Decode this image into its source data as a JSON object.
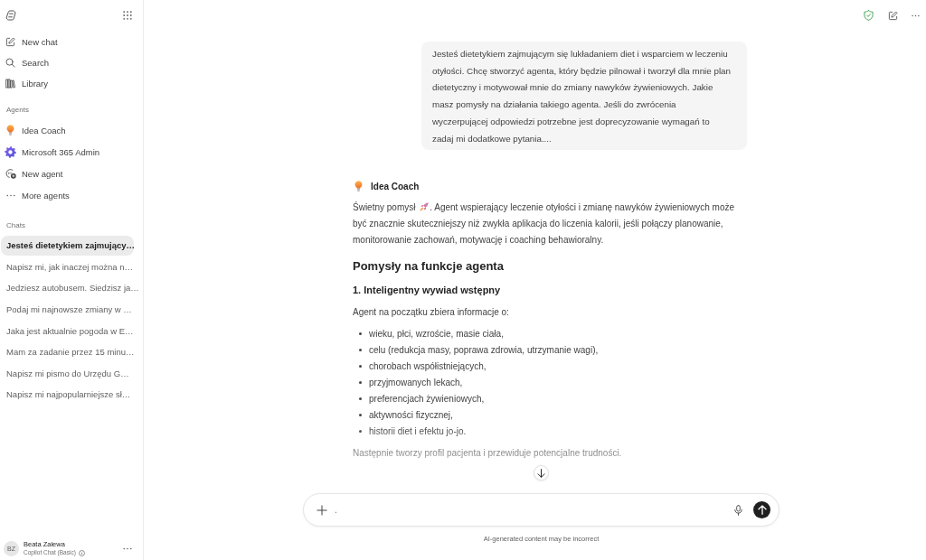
{
  "sidebar": {
    "nav": [
      {
        "label": "New chat"
      },
      {
        "label": "Search"
      },
      {
        "label": "Library"
      }
    ],
    "agents_heading": "Agents",
    "agents": [
      {
        "label": "Idea Coach"
      },
      {
        "label": "Microsoft 365 Admin"
      },
      {
        "label": "New agent"
      },
      {
        "label": "More agents"
      }
    ],
    "chats_heading": "Chats",
    "chats": [
      {
        "label": "Jesteś dietetykiem zajmujący…",
        "selected": true
      },
      {
        "label": "Napisz mi, jak inaczej można n…",
        "selected": false
      },
      {
        "label": "Jedziesz autobusem. Siedzisz ja…",
        "selected": false
      },
      {
        "label": "Podaj mi najnowsze zmiany w …",
        "selected": false
      },
      {
        "label": "Jaka jest aktualnie pogoda w E…",
        "selected": false
      },
      {
        "label": "Mam za zadanie przez 15 minu…",
        "selected": false
      },
      {
        "label": "Napisz mi pismo do Urzędu G…",
        "selected": false
      },
      {
        "label": "Napisz mi najpopularniejsze sł…",
        "selected": false
      }
    ],
    "account": {
      "initials": "BZ",
      "name": "Beata Zalewa",
      "plan": "Copilot Chat (Basic)"
    }
  },
  "conversation": {
    "user_message": "Jesteś dietetykiem zajmującym się lukładaniem diet i wsparciem w leczeniu otyłości. Chcę stworzyć agenta, który będzie pilnował i tworzył dla mnie plan dietetyczny i motywował mnie do zmiany nawyków żywieniowych. Jakie masz pomysły na działania takiego agenta. Jeśli do zwrócenia wyczerpującej odpowiedzi potrzebne jest doprecyzowanie wymagań to zadaj mi dodatkowe pytania....",
    "reply": {
      "agent": "Idea Coach",
      "intro": {
        "lead": "Świetny pomysł",
        "rest": ". Agent wspierający leczenie otyłości i zmianę nawyków żywieniowych może być znacznie skuteczniejszy niż zwykła aplikacja do liczenia kalorii, jeśli połączy planowanie, monitorowanie zachowań, motywację i coaching behawioralny."
      },
      "heading": "Pomysły na funkcje agenta",
      "subheading": "1. Inteligentny wywiad wstępny",
      "list_intro": "Agent na początku zbiera informacje o:",
      "bullets": [
        "wieku, płci, wzroście, masie ciała,",
        "celu (redukcja masy, poprawa zdrowia, utrzymanie wagi),",
        "chorobach współistniejących,",
        "przyjmowanych lekach,",
        "preferencjach żywieniowych,",
        "aktywności fizycznej,",
        "historii diet i efektu jo-jo."
      ],
      "closing": "Następnie tworzy profil pacjenta i przewiduje potencjalne trudności."
    }
  },
  "composer": {
    "value": "."
  },
  "disclaimer": "AI-generated content may be incorrect"
}
